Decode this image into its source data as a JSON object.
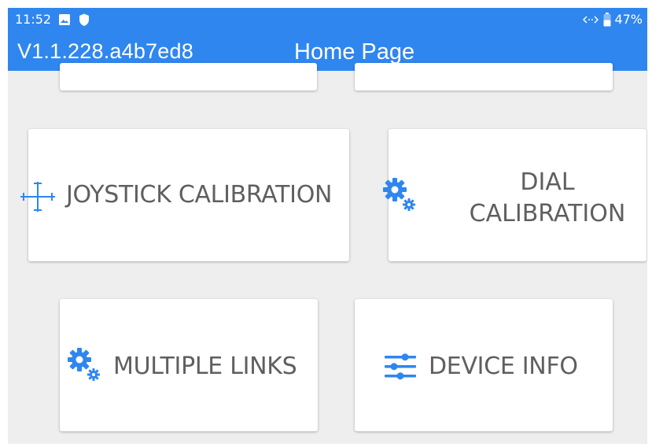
{
  "status_bar": {
    "time": "11:52",
    "left_icons": [
      "image-icon",
      "shield-icon"
    ],
    "right_icons": [
      "data-arrows-icon",
      "battery-icon"
    ],
    "battery": "47%"
  },
  "header": {
    "version": "V1.1.228.a4b7ed8",
    "title": "Home Page"
  },
  "colors": {
    "primary": "#2f86ef",
    "icon": "#2f86ef",
    "card_text": "#5f5f5f",
    "background": "#eeeeee"
  },
  "menu": {
    "joystick": {
      "label": "JOYSTICK CALIBRATION",
      "icon": "crosshair-icon"
    },
    "dial": {
      "line1": "DIAL",
      "line2": "CALIBRATION",
      "icon": "gears-icon"
    },
    "links": {
      "label": "MULTIPLE LINKS",
      "icon": "gears-icon"
    },
    "device": {
      "label": "DEVICE INFO",
      "icon": "sliders-icon"
    }
  }
}
